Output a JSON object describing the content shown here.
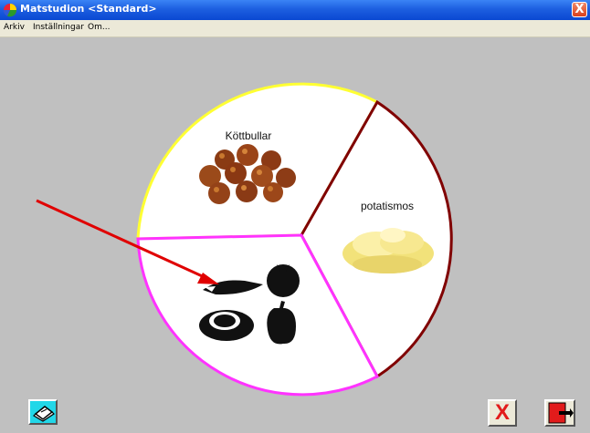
{
  "window": {
    "title": "Matstudion <Standard>",
    "close_glyph": "X"
  },
  "menu": {
    "items": [
      "Arkiv",
      "Inställningar",
      "Om..."
    ]
  },
  "plate": {
    "sections": [
      {
        "label": "Köttbullar",
        "border_color": "#ffff33",
        "icon": "meatballs-image"
      },
      {
        "label": "potatismos",
        "border_color": "#800000",
        "icon": "mashed-potato-image"
      },
      {
        "label": "",
        "border_color": "#ff33ff",
        "icon": "vegetables-silhouettes-image"
      }
    ]
  },
  "annotation": {
    "arrow_color": "#e00000"
  },
  "toolbar": {
    "print_icon": "printer-icon",
    "cancel_label": "X",
    "exit_icon": "exit-door-icon"
  }
}
